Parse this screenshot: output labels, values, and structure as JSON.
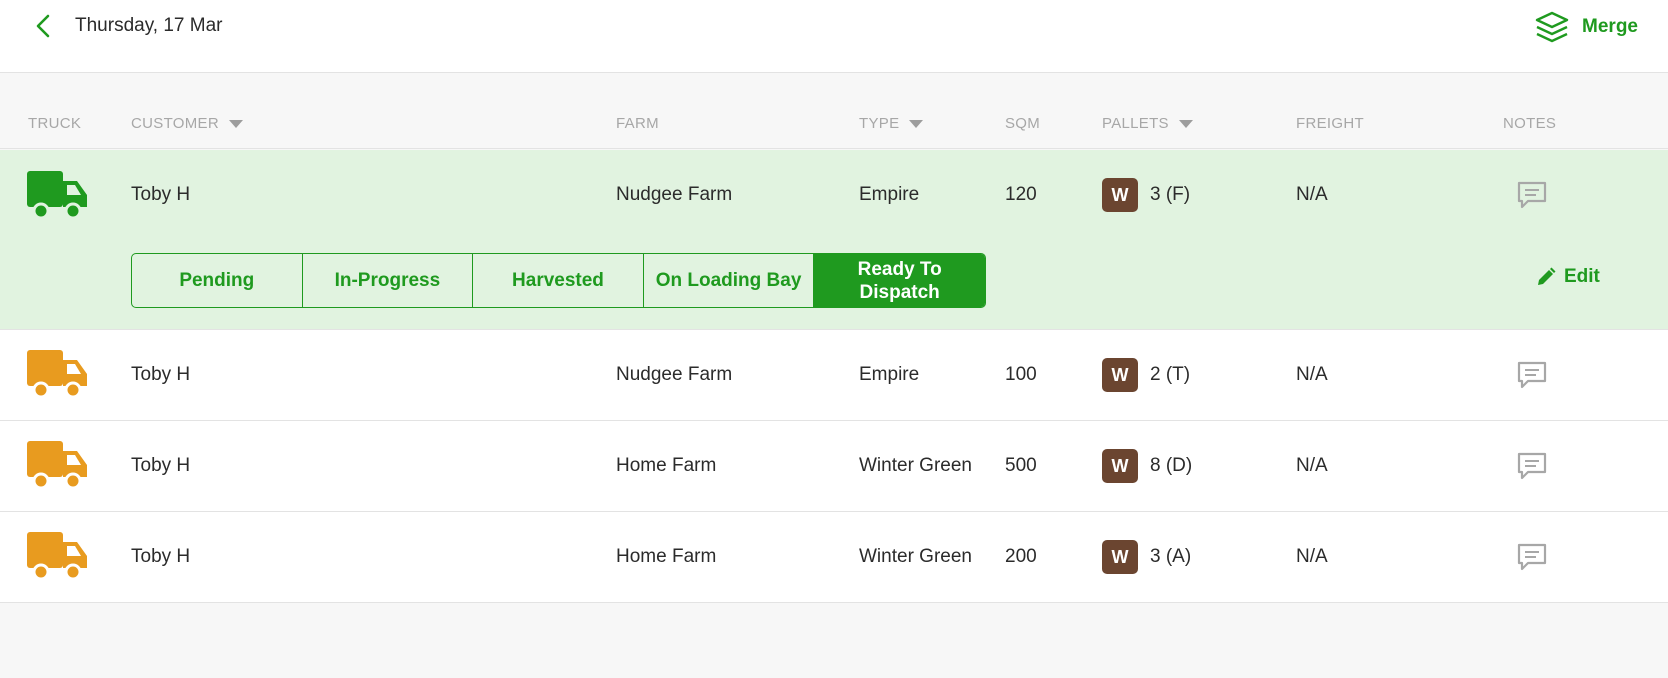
{
  "header": {
    "date": "Thursday, 17 Mar",
    "merge_label": "Merge"
  },
  "columns": {
    "truck": "TRUCK",
    "customer": "CUSTOMER",
    "farm": "FARM",
    "type": "TYPE",
    "sqm": "SQM",
    "pallets": "PALLETS",
    "freight": "FREIGHT",
    "notes": "NOTES"
  },
  "rows": [
    {
      "truck_status": "dispatched",
      "truck_color": "#1f9a1f",
      "customer": "Toby H",
      "farm": "Nudgee Farm",
      "type": "Empire",
      "sqm": "120",
      "pallet_badge": "W",
      "pallets": "3 (F)",
      "freight": "N/A"
    },
    {
      "truck_status": "pending",
      "truck_color": "#e89b1f",
      "customer": "Toby H",
      "farm": "Nudgee Farm",
      "type": "Empire",
      "sqm": "100",
      "pallet_badge": "W",
      "pallets": "2 (T)",
      "freight": "N/A"
    },
    {
      "truck_status": "pending",
      "truck_color": "#e89b1f",
      "customer": "Toby H",
      "farm": "Home Farm",
      "type": "Winter Green",
      "sqm": "500",
      "pallet_badge": "W",
      "pallets": "8 (D)",
      "freight": "N/A"
    },
    {
      "truck_status": "pending",
      "truck_color": "#e89b1f",
      "customer": "Toby H",
      "farm": "Home Farm",
      "type": "Winter Green",
      "sqm": "200",
      "pallet_badge": "W",
      "pallets": "3 (A)",
      "freight": "N/A"
    }
  ],
  "status_options": {
    "pending": "Pending",
    "in_progress": "In-Progress",
    "harvested": "Harvested",
    "on_loading_bay": "On Loading Bay",
    "ready_to_dispatch": "Ready To Dispatch",
    "active": "ready_to_dispatch"
  },
  "edit_label": "Edit",
  "icons": {
    "back": "chevron-left-icon",
    "merge": "layers-icon",
    "sort": "caret-down-icon",
    "truck": "truck-icon",
    "notes": "comment-icon",
    "edit": "pencil-icon"
  },
  "colors": {
    "accent": "#1f9a1f",
    "selected_row": "#e1f3e0",
    "pending_truck": "#e89b1f",
    "pallet_badge": "#6b4530"
  }
}
